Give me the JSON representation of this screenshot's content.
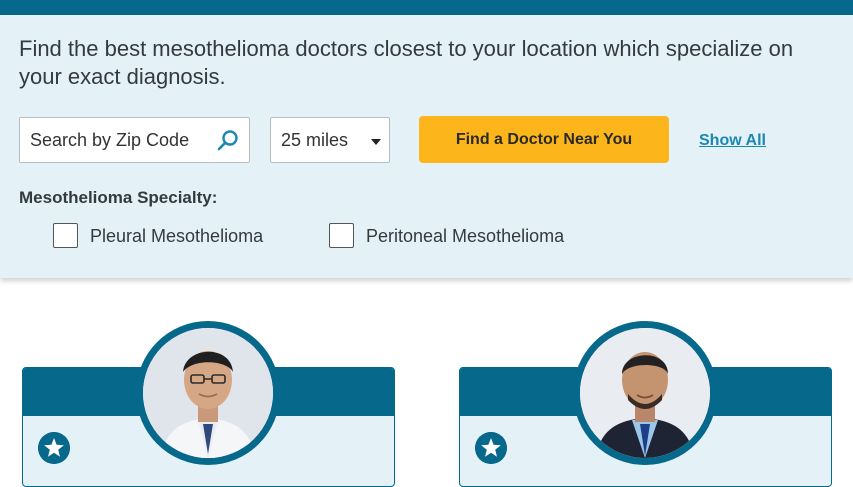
{
  "intro_text": "Find the best mesothelioma doctors closest to your location which specialize on your exact diagnosis.",
  "search": {
    "placeholder": "Search by Zip Code"
  },
  "distance": {
    "selected": "25 miles"
  },
  "find_button_label": "Find a Doctor Near You",
  "show_all_label": "Show All",
  "specialty": {
    "label": "Mesothelioma Specialty:",
    "options": [
      "Pleural Mesothelioma",
      "Peritoneal Mesothelioma"
    ]
  },
  "colors": {
    "primary": "#06688a",
    "panel_bg": "#e4f1f6",
    "button": "#fcb61c",
    "link": "#1a88b0"
  }
}
